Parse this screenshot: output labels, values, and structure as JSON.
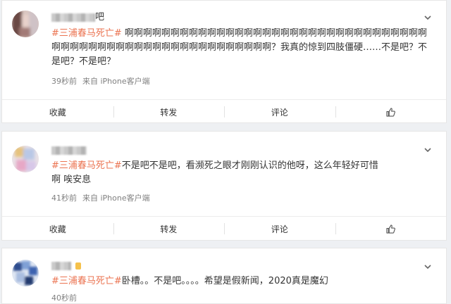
{
  "posts": [
    {
      "name_suffix": "吧",
      "hashtag": "#三浦春马死亡#",
      "text": " 啊啊啊啊啊啊啊啊啊啊啊啊啊啊啊啊啊啊啊啊啊啊啊啊啊啊啊啊啊啊啊啊啊啊啊啊啊啊啊啊啊啊啊啊啊啊啊啊啊啊啊啊啊啊啊啊啊？我真的惊到四肢僵硬……不是吧？不是吧？不是吧？",
      "time": "39秒前",
      "source": "来自 iPhone客户端"
    },
    {
      "name_suffix": "",
      "hashtag": "#三浦春马死亡#",
      "text": "不是吧不是吧，看濒死之眼才刚刚认识的他呀，这么年轻好可惜啊 唉安息",
      "time": "41秒前",
      "source": "来自 iPhone客户端"
    },
    {
      "name_suffix": "",
      "hashtag": "#三浦春马死亡#",
      "text": "卧槽。。不是吧。。。。希望是假新闻，2020真是魔幻",
      "time": "40秒前",
      "source": ""
    }
  ],
  "actions": {
    "favorite": "收藏",
    "repost": "转发",
    "comment": "评论"
  },
  "colors": {
    "hashtag": "#eb7350",
    "background": "#eef0f3"
  }
}
